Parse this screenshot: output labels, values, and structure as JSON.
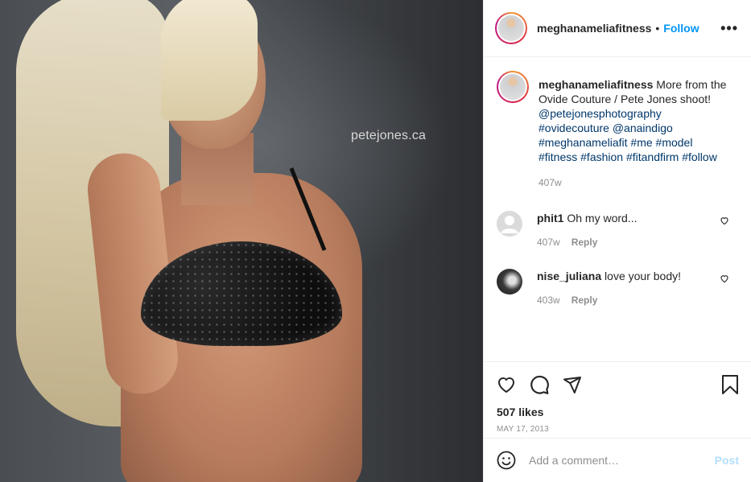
{
  "photo": {
    "watermark": "petejones.ca"
  },
  "header": {
    "username": "meghanameliafitness",
    "separator": "•",
    "follow_label": "Follow",
    "more_label": "•••"
  },
  "caption": {
    "username": "meghanameliafitness",
    "text": "More from the Ovide Couture / Pete Jones shoot!",
    "tags": [
      "@petejonesphotography",
      "#ovidecouture",
      "@anaindigo",
      "#meghanameliafit",
      "#me",
      "#model",
      "#fitness",
      "#fashion",
      "#fitandfirm",
      "#follow"
    ],
    "time": "407w"
  },
  "comments": [
    {
      "username": "phit1",
      "text": "Oh my word...",
      "time": "407w",
      "reply_label": "Reply"
    },
    {
      "username": "nise_juliana",
      "text": "love your body!",
      "time": "403w",
      "reply_label": "Reply"
    }
  ],
  "actions": {
    "likes": "507 likes",
    "date": "MAY 17, 2013"
  },
  "add_comment": {
    "placeholder": "Add a comment…",
    "post_label": "Post"
  },
  "colors": {
    "link": "#0095f6",
    "hashtag": "#00376b",
    "meta": "#8e8e8e",
    "post_disabled": "#b2dffc"
  }
}
